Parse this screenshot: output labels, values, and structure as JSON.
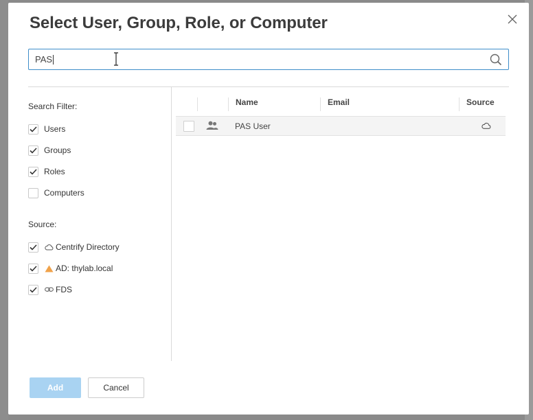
{
  "dialog": {
    "title": "Select User, Group, Role, or Computer",
    "close_icon": "close-icon"
  },
  "search": {
    "value": "PAS",
    "icon": "search-icon"
  },
  "filters": {
    "search_filter_label": "Search Filter:",
    "items": [
      {
        "label": "Users",
        "checked": true
      },
      {
        "label": "Groups",
        "checked": true
      },
      {
        "label": "Roles",
        "checked": true
      },
      {
        "label": "Computers",
        "checked": false
      }
    ],
    "source_label": "Source:",
    "sources": [
      {
        "label": "Centrify Directory",
        "checked": true,
        "icon": "cloud-icon"
      },
      {
        "label": "AD: thylab.local",
        "checked": true,
        "icon": "warning-triangle-icon",
        "icon_color": "#f0a24a"
      },
      {
        "label": "FDS",
        "checked": true,
        "icon": "link-icon"
      }
    ]
  },
  "results": {
    "columns": [
      "Name",
      "Email",
      "Source"
    ],
    "rows": [
      {
        "name": "PAS User",
        "email": "",
        "type_icon": "group-icon",
        "source_icon": "cloud-icon",
        "checked": false
      }
    ]
  },
  "footer": {
    "add_label": "Add",
    "cancel_label": "Cancel"
  },
  "colors": {
    "accent": "#3d8dc9",
    "add_button": "#a9d3f2"
  }
}
